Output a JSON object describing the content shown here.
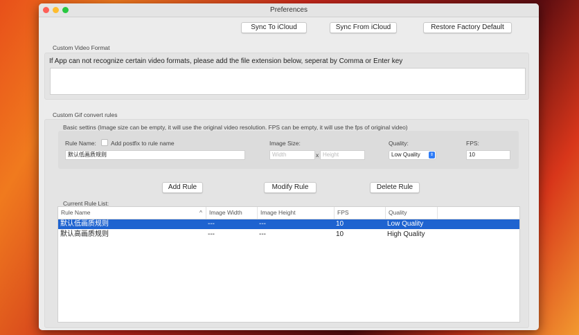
{
  "window": {
    "title": "Preferences"
  },
  "toolbar": {
    "sync_to": "Sync To iCloud",
    "sync_from": "Sync From iCloud",
    "restore": "Restore Factory Default"
  },
  "video_format": {
    "section_label": "Custom Video Format",
    "description": "If App can not recognize certain video formats, please add the file extension below, seperat by Comma or Enter key",
    "value": ""
  },
  "gif_rules": {
    "section_label": "Custom Gif convert rules",
    "basic_label": "Basic settins (Image size can be empty, it will use the original video resolution. FPS can be empty, it will use the fps of original video)",
    "rule_name_label": "Rule Name:",
    "postfix_label": "Add postfix to rule name",
    "rule_name_value": "默认低画质规则",
    "image_size_label": "Image Size:",
    "width_placeholder": "Width",
    "x_sep": "x",
    "height_placeholder": "Height",
    "quality_label": "Quality:",
    "quality_value": "Low Quality",
    "fps_label": "FPS:",
    "fps_value": "10",
    "add": "Add Rule",
    "modify": "Modify Rule",
    "delete": "Delete Rule",
    "list_label": "Current Rule List:"
  },
  "table": {
    "columns": [
      "Rule Name",
      "Image Width",
      "Image Height",
      "FPS",
      "Quality"
    ],
    "rows": [
      {
        "name": "默认低画质规则",
        "width": "---",
        "height": "---",
        "fps": "10",
        "quality": "Low Quality"
      },
      {
        "name": "默认高画质规则",
        "width": "---",
        "height": "---",
        "fps": "10",
        "quality": "High Quality"
      }
    ]
  },
  "colors": {
    "selection": "#1e63d0",
    "accent": "#2f7cf6"
  }
}
